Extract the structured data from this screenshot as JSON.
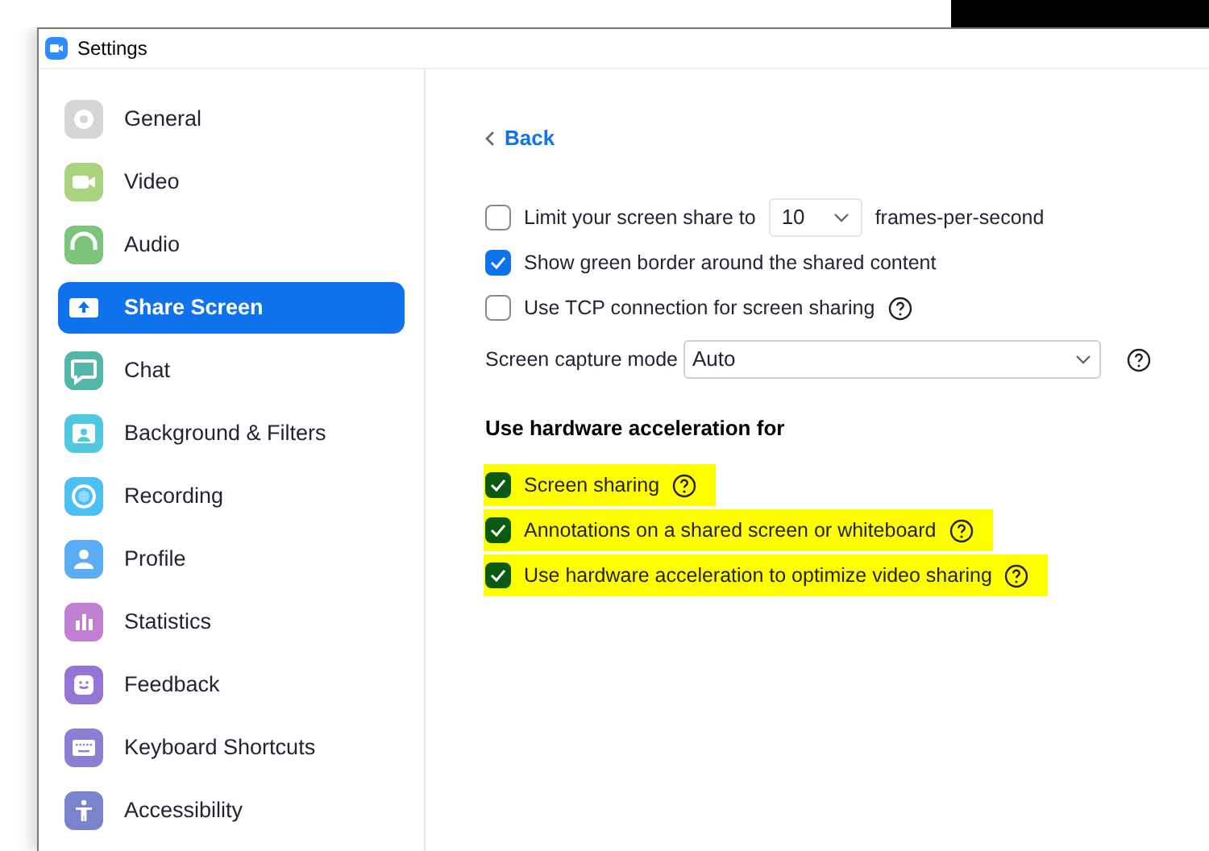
{
  "window": {
    "title": "Settings"
  },
  "sidebar": {
    "items": [
      {
        "label": "General",
        "selected": false,
        "color": "#d6d6d6"
      },
      {
        "label": "Video",
        "selected": false,
        "color": "#a9d37f"
      },
      {
        "label": "Audio",
        "selected": false,
        "color": "#7cc47a"
      },
      {
        "label": "Share Screen",
        "selected": true,
        "color": "#ffffff"
      },
      {
        "label": "Chat",
        "selected": false,
        "color": "#52b6a8"
      },
      {
        "label": "Background & Filters",
        "selected": false,
        "color": "#4ec9de"
      },
      {
        "label": "Recording",
        "selected": false,
        "color": "#4cc0f5"
      },
      {
        "label": "Profile",
        "selected": false,
        "color": "#5aadf5"
      },
      {
        "label": "Statistics",
        "selected": false,
        "color": "#c07fd0"
      },
      {
        "label": "Feedback",
        "selected": false,
        "color": "#9574d4"
      },
      {
        "label": "Keyboard Shortcuts",
        "selected": false,
        "color": "#8b7fd4"
      },
      {
        "label": "Accessibility",
        "selected": false,
        "color": "#7a84cc"
      }
    ]
  },
  "back": "Back",
  "settings": [
    {
      "kind": "checkbox",
      "label": "Limit your screen share to",
      "checked": false,
      "highlighted": false,
      "select": {
        "value": "10"
      },
      "suffix": "frames-per-second"
    },
    {
      "kind": "checkbox",
      "label": "Show green border around the shared content",
      "checked": true,
      "highlighted": false
    },
    {
      "kind": "checkbox",
      "label": "Use TCP connection for screen sharing",
      "checked": false,
      "highlighted": false,
      "help": true
    },
    {
      "kind": "select",
      "label": "Screen capture mode",
      "value": "Auto",
      "help": true
    },
    {
      "kind": "heading",
      "label": "Use hardware acceleration for"
    },
    {
      "kind": "checkbox",
      "label": "Screen sharing",
      "checked": true,
      "highlighted": true,
      "help": true
    },
    {
      "kind": "checkbox",
      "label": "Annotations on a shared screen or whiteboard",
      "checked": true,
      "highlighted": true,
      "help": true
    },
    {
      "kind": "checkbox",
      "label": "Use hardware acceleration to optimize video sharing",
      "checked": true,
      "highlighted": true,
      "help": true
    }
  ]
}
